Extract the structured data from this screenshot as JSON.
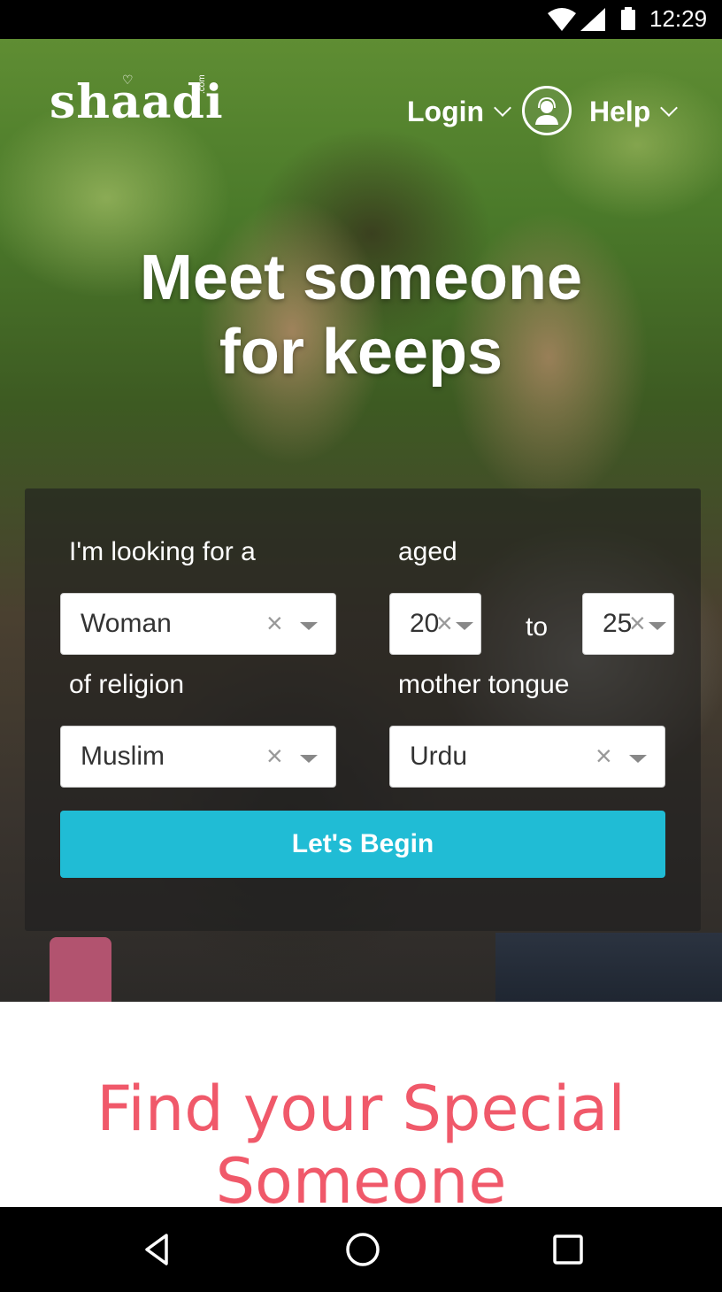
{
  "status_bar": {
    "time": "12:29",
    "icons": [
      "wifi-icon",
      "signal-icon",
      "battery-icon"
    ]
  },
  "header": {
    "logo_text": "shaadi",
    "logo_suffix": ".com",
    "login_label": "Login",
    "help_label": "Help",
    "avatar_icon": "support-agent-icon"
  },
  "hero": {
    "headline_line1": "Meet someone",
    "headline_line2": "for keeps"
  },
  "search": {
    "looking_for_label": "I'm looking for a",
    "aged_label": "aged",
    "gender_value": "Woman",
    "age_from_value": "20",
    "to_label": "to",
    "age_to_value": "25",
    "religion_label": "of religion",
    "mother_tongue_label": "mother tongue",
    "religion_value": "Muslim",
    "mother_tongue_value": "Urdu",
    "clear_glyph": "×",
    "submit_label": "Let's Begin"
  },
  "section": {
    "title_line1": "Find your Special",
    "title_line2": "Someone"
  },
  "colors": {
    "accent": "#20bcd5",
    "title_pink": "#f0596a",
    "panel_overlay": "rgba(30,30,30,0.62)"
  },
  "nav_bar": {
    "icons": [
      "back-icon",
      "home-icon",
      "recents-icon"
    ]
  }
}
